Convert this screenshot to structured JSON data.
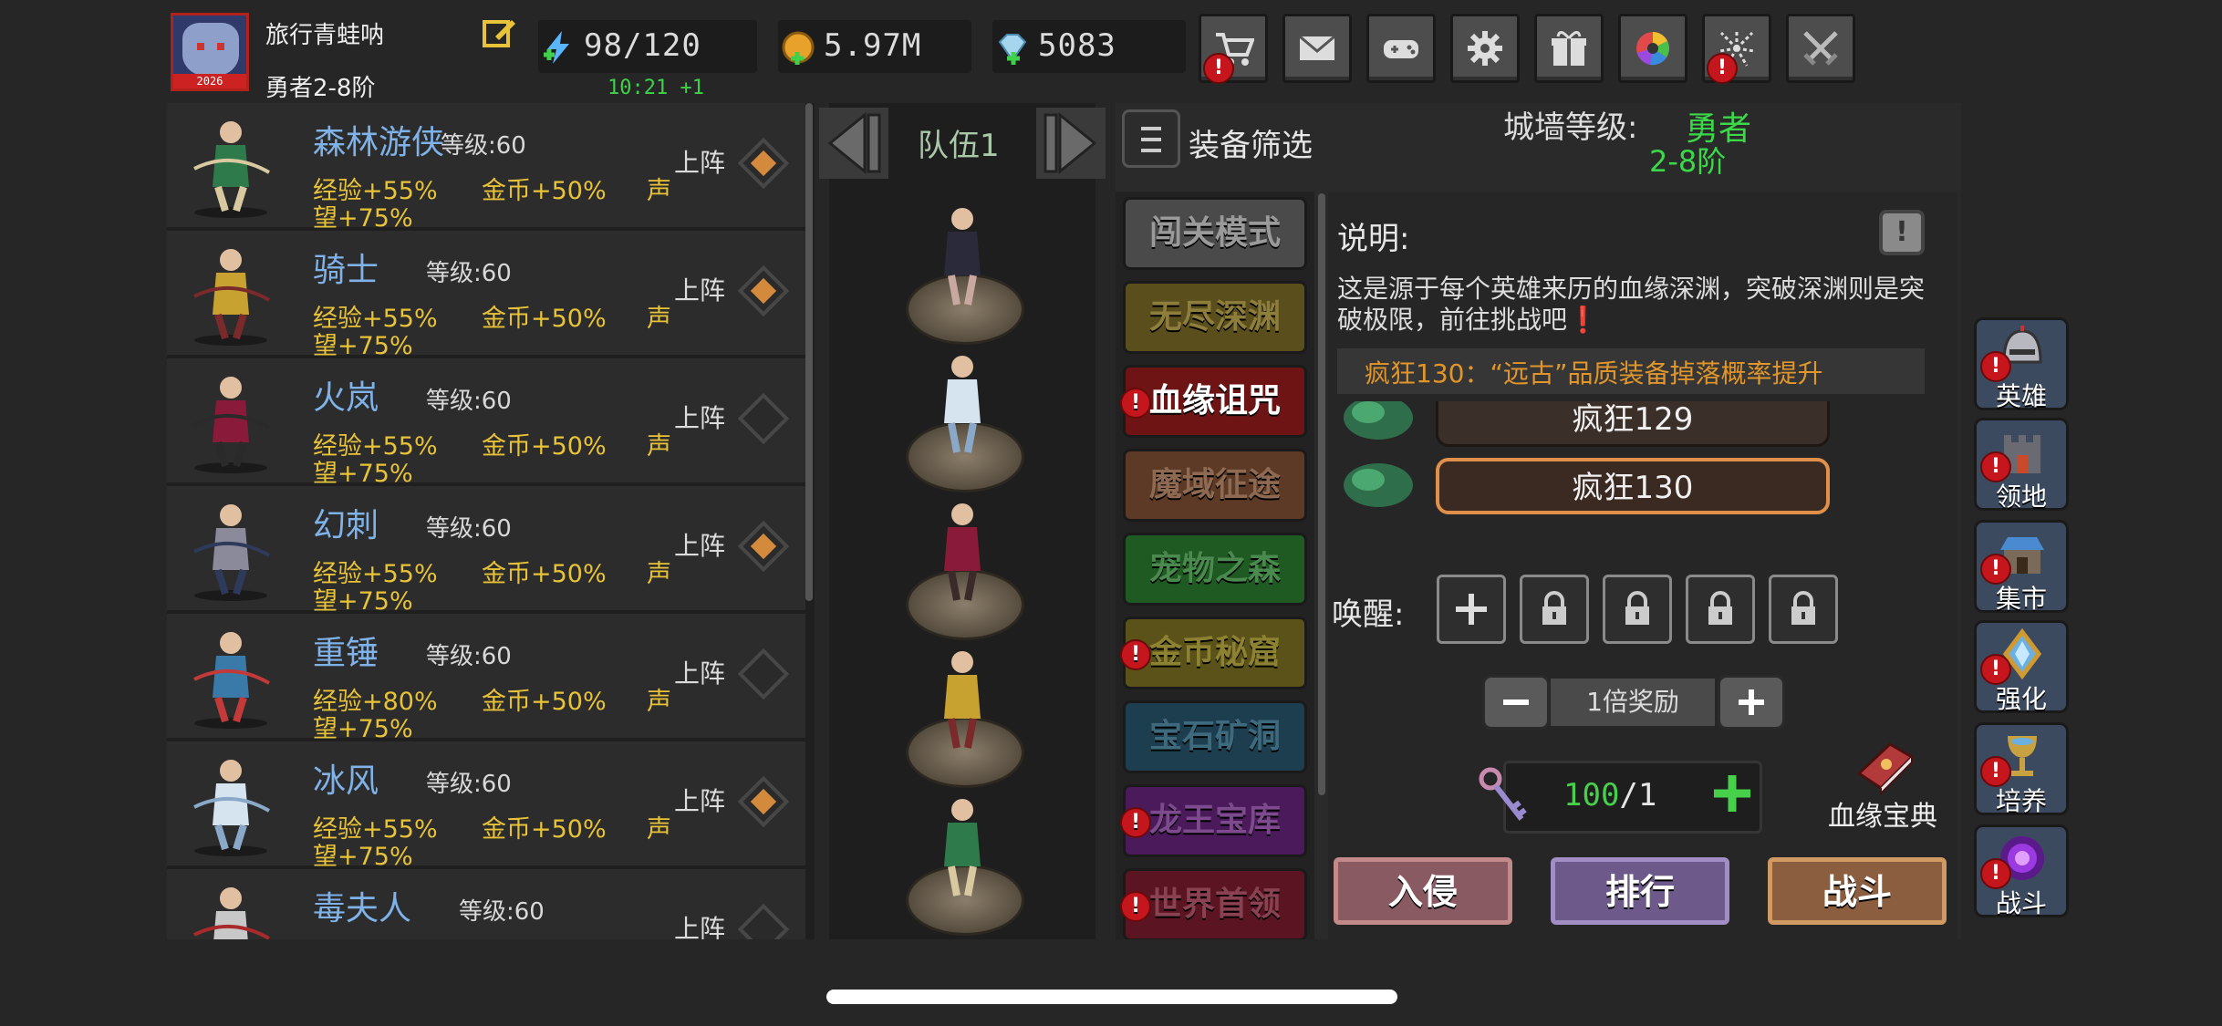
{
  "player": {
    "name": "旅行青蛙呐",
    "rank": "勇者2-8阶",
    "avatar_badge": "2026"
  },
  "resources": {
    "energy": "98/120",
    "energy_timer": "10:21 +1",
    "gold": "5.97M",
    "gems": "5083"
  },
  "toolbar": [
    {
      "icon": "shop-cart-icon",
      "alert": true
    },
    {
      "icon": "mail-icon",
      "alert": false
    },
    {
      "icon": "gamepad-icon",
      "alert": false
    },
    {
      "icon": "settings-gear-icon",
      "alert": false
    },
    {
      "icon": "gift-icon",
      "alert": false
    },
    {
      "icon": "color-wheel-icon",
      "alert": false
    },
    {
      "icon": "fireworks-icon",
      "alert": true
    },
    {
      "icon": "crossed-swords-icon",
      "alert": false
    }
  ],
  "heroes": [
    {
      "name": "森林游侠",
      "level": "等级:60",
      "exp": "经验+55%",
      "gold": "金币+50%",
      "fame_a": "声",
      "fame_b": "望+75%",
      "deploy": "上阵",
      "selected": true
    },
    {
      "name": "骑士",
      "level": "等级:60",
      "exp": "经验+55%",
      "gold": "金币+50%",
      "fame_a": "声",
      "fame_b": "望+75%",
      "deploy": "上阵",
      "selected": true
    },
    {
      "name": "火岚",
      "level": "等级:60",
      "exp": "经验+55%",
      "gold": "金币+50%",
      "fame_a": "声",
      "fame_b": "望+75%",
      "deploy": "上阵",
      "selected": false
    },
    {
      "name": "幻刺",
      "level": "等级:60",
      "exp": "经验+55%",
      "gold": "金币+50%",
      "fame_a": "声",
      "fame_b": "望+75%",
      "deploy": "上阵",
      "selected": true
    },
    {
      "name": "重锤",
      "level": "等级:60",
      "exp": "经验+80%",
      "gold": "金币+50%",
      "fame_a": "声",
      "fame_b": "望+75%",
      "deploy": "上阵",
      "selected": false
    },
    {
      "name": "冰风",
      "level": "等级:60",
      "exp": "经验+55%",
      "gold": "金币+50%",
      "fame_a": "声",
      "fame_b": "望+75%",
      "deploy": "上阵",
      "selected": true
    },
    {
      "name": "毒夫人",
      "level": "等级:60",
      "exp": "",
      "gold": "",
      "fame_a": "",
      "fame_b": "",
      "deploy": "上阵",
      "selected": false
    }
  ],
  "team": {
    "label": "队伍1"
  },
  "filter": {
    "label": "装备筛选"
  },
  "wall": {
    "label": "城墙等级:",
    "value1": "勇者",
    "value2": "2-8阶"
  },
  "modes": [
    {
      "label": "闯关模式",
      "alert": false,
      "bg": "#4a4a4a",
      "color": "#9a9a9a"
    },
    {
      "label": "无尽深渊",
      "alert": false,
      "bg": "#5a4e1c",
      "color": "#8e7e3c"
    },
    {
      "label": "血缘诅咒",
      "alert": true,
      "bg": "#6e1414",
      "color": "#ffffff"
    },
    {
      "label": "魔域征途",
      "alert": false,
      "bg": "#5c3a26",
      "color": "#8e6a52"
    },
    {
      "label": "宠物之森",
      "alert": false,
      "bg": "#1e5a22",
      "color": "#4a8a4e"
    },
    {
      "label": "金币秘窟",
      "alert": true,
      "bg": "#5a5218",
      "color": "#8c8232"
    },
    {
      "label": "宝石矿洞",
      "alert": false,
      "bg": "#1c3e4e",
      "color": "#3e6a7e"
    },
    {
      "label": "龙王宝库",
      "alert": true,
      "bg": "#4a1a5a",
      "color": "#7e4a8e"
    },
    {
      "label": "世界首领",
      "alert": true,
      "bg": "#5a1422",
      "color": "#8a4252"
    }
  ],
  "detail": {
    "title": "说明:",
    "info_glyph": "!",
    "description": "这是源于每个英雄来历的血缘深渊，突破深渊则是突破极限，前往挑战吧❗",
    "bonus": "疯狂130：“远古”品质装备掉落概率提升",
    "levels": [
      "疯狂129",
      "疯狂130"
    ],
    "awaken_label": "唤醒:",
    "multiplier": "1倍奖励",
    "tickets_current": "100",
    "tickets_max": "/1",
    "codex_label": "血缘宝典"
  },
  "actions": {
    "invade": "入侵",
    "rank": "排行",
    "fight": "战斗"
  },
  "side_nav": [
    {
      "label": "英雄",
      "icon": "helmet-icon",
      "alert": true
    },
    {
      "label": "领地",
      "icon": "castle-icon",
      "alert": true
    },
    {
      "label": "集市",
      "icon": "market-icon",
      "alert": true
    },
    {
      "label": "强化",
      "icon": "enhance-crystal-icon",
      "alert": true
    },
    {
      "label": "培养",
      "icon": "chalice-icon",
      "alert": true
    },
    {
      "label": "战斗",
      "icon": "portal-icon",
      "alert": true
    }
  ]
}
